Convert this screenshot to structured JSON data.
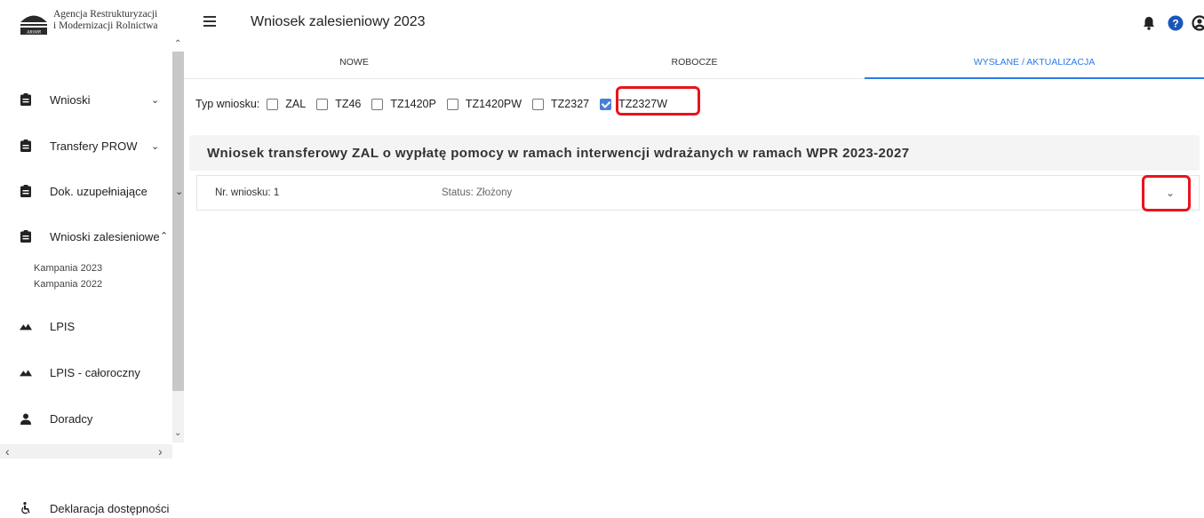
{
  "brand": {
    "line1": "Agencja Restrukturyzacji",
    "line2": "i Modernizacji Rolnictwa",
    "mark_text": "ARiMR"
  },
  "header": {
    "title": "Wniosek zalesieniowy 2023",
    "icons": [
      "bell-icon",
      "help-icon",
      "account-icon"
    ]
  },
  "sidebar": {
    "items": [
      {
        "label": "Wnioski",
        "icon": "clipboard-icon"
      },
      {
        "label": "Transfery PROW",
        "icon": "clipboard-icon"
      },
      {
        "label": "Dok. uzupełniające",
        "icon": "clipboard-icon"
      },
      {
        "label": "Wnioski zalesieniowe",
        "icon": "clipboard-icon"
      },
      {
        "label": "LPIS",
        "icon": "terrain-icon"
      },
      {
        "label": "LPIS - całoroczny",
        "icon": "terrain-icon"
      },
      {
        "label": "Doradcy",
        "icon": "person-icon"
      }
    ],
    "subitems": [
      "Kampania 2023",
      "Kampania 2022"
    ],
    "footer": "Deklaracja dostępności"
  },
  "tabs": [
    "NOWE",
    "ROBOCZE",
    "WYSŁANE / AKTUALIZACJA"
  ],
  "filters": {
    "label": "Typ wniosku:",
    "options": [
      {
        "label": "ZAL",
        "checked": false
      },
      {
        "label": "TZ46",
        "checked": false
      },
      {
        "label": "TZ1420P",
        "checked": false
      },
      {
        "label": "TZ1420PW",
        "checked": false
      },
      {
        "label": "TZ2327",
        "checked": false
      },
      {
        "label": "TZ2327W",
        "checked": true
      }
    ]
  },
  "panel": {
    "title": "Wniosek transferowy ZAL o wypłatę pomocy w ramach interwencji wdrażanych w ramach WPR 2023-2027"
  },
  "row": {
    "nr": "Nr. wniosku: 1",
    "status": "Status: Złożony"
  },
  "colors": {
    "accent": "#2c7be5",
    "highlight": "#e8141c",
    "checkbox": "#4a7fd6"
  }
}
